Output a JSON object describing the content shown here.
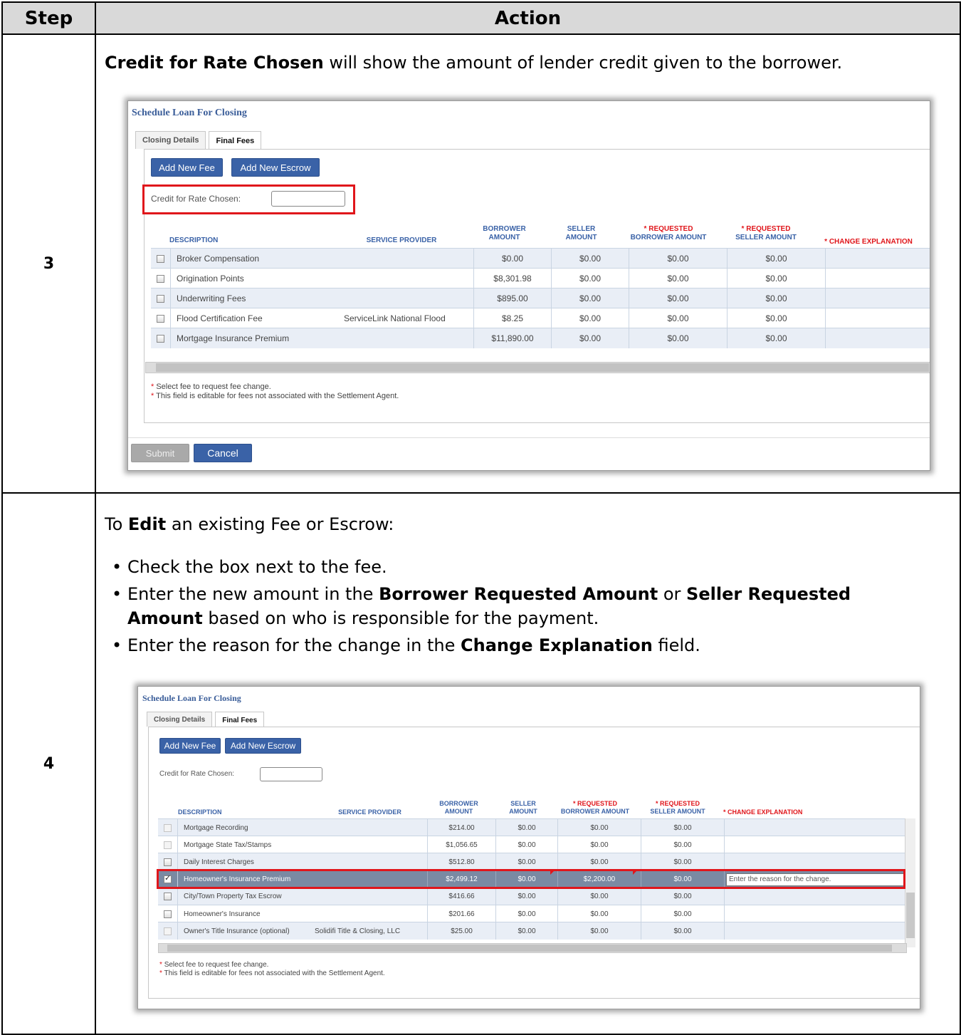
{
  "table": {
    "header_step": "Step",
    "header_action": "Action"
  },
  "step3": {
    "number": "3",
    "intro_bold": "Credit for Rate Chosen",
    "intro_rest": " will show the amount of lender credit given to the borrower.",
    "screenshot": {
      "title": "Schedule Loan For Closing",
      "tabs": [
        "Closing Details",
        "Final Fees"
      ],
      "add_fee": "Add New Fee",
      "add_escrow": "Add New Escrow",
      "credit_label": "Credit for Rate Chosen:",
      "columns": {
        "description": "DESCRIPTION",
        "provider": "SERVICE PROVIDER",
        "borrower_1": "BORROWER",
        "borrower_2": "AMOUNT",
        "seller_1": "SELLER",
        "seller_2": "AMOUNT",
        "req_borrower_1": "REQUESTED",
        "req_borrower_2": "BORROWER AMOUNT",
        "req_seller_1": "REQUESTED",
        "req_seller_2": "SELLER AMOUNT",
        "explanation": "CHANGE EXPLANATION",
        "required_mark": "*"
      },
      "rows": [
        {
          "description": "Broker Compensation",
          "provider": "",
          "borrower": "$0.00",
          "seller": "$0.00",
          "req_borrower": "$0.00",
          "req_seller": "$0.00"
        },
        {
          "description": "Origination Points",
          "provider": "",
          "borrower": "$8,301.98",
          "seller": "$0.00",
          "req_borrower": "$0.00",
          "req_seller": "$0.00"
        },
        {
          "description": "Underwriting Fees",
          "provider": "",
          "borrower": "$895.00",
          "seller": "$0.00",
          "req_borrower": "$0.00",
          "req_seller": "$0.00"
        },
        {
          "description": "Flood Certification Fee",
          "provider": "ServiceLink National Flood",
          "borrower": "$8.25",
          "seller": "$0.00",
          "req_borrower": "$0.00",
          "req_seller": "$0.00"
        },
        {
          "description": "Mortgage Insurance Premium",
          "provider": "",
          "borrower": "$11,890.00",
          "seller": "$0.00",
          "req_borrower": "$0.00",
          "req_seller": "$0.00"
        }
      ],
      "note_1": "Select fee to request fee change.",
      "note_2": "This field is editable for fees not associated with the Settlement Agent.",
      "submit": "Submit",
      "cancel": "Cancel"
    }
  },
  "step4": {
    "number": "4",
    "intro_pre": "To ",
    "intro_bold": "Edit",
    "intro_rest": " an existing Fee or Escrow:",
    "bullets": {
      "b1": "Check the box next to the fee.",
      "b2_pre": "Enter the new amount in the ",
      "b2_bold1": "Borrower Requested Amount",
      "b2_mid": " or ",
      "b2_bold2": "Seller Requested Amount",
      "b2_rest": " based on who is responsible for the payment.",
      "b3_pre": "Enter the reason for the change in the ",
      "b3_bold": "Change Explanation",
      "b3_rest": " field."
    },
    "screenshot": {
      "title": "Schedule Loan For Closing",
      "tabs": [
        "Closing Details",
        "Final Fees"
      ],
      "add_fee": "Add New Fee",
      "add_escrow": "Add New Escrow",
      "credit_label": "Credit for Rate Chosen:",
      "rows": [
        {
          "description": "Mortgage Recording",
          "provider": "",
          "borrower": "$214.00",
          "seller": "$0.00",
          "req_borrower": "$0.00",
          "req_seller": "$0.00",
          "checked": false
        },
        {
          "description": "Mortgage State Tax/Stamps",
          "provider": "",
          "borrower": "$1,056.65",
          "seller": "$0.00",
          "req_borrower": "$0.00",
          "req_seller": "$0.00",
          "checked": false
        },
        {
          "description": "Daily Interest Charges",
          "provider": "",
          "borrower": "$512.80",
          "seller": "$0.00",
          "req_borrower": "$0.00",
          "req_seller": "$0.00",
          "checked": false
        },
        {
          "description": "Homeowner's Insurance Premium",
          "provider": "",
          "borrower": "$2,499.12",
          "seller": "$0.00",
          "req_borrower": "$2,200.00",
          "req_seller": "$0.00",
          "checked": true,
          "explanation": "Enter the reason for the change."
        },
        {
          "description": "City/Town Property Tax Escrow",
          "provider": "",
          "borrower": "$416.66",
          "seller": "$0.00",
          "req_borrower": "$0.00",
          "req_seller": "$0.00",
          "checked": false
        },
        {
          "description": "Homeowner's Insurance",
          "provider": "",
          "borrower": "$201.66",
          "seller": "$0.00",
          "req_borrower": "$0.00",
          "req_seller": "$0.00",
          "checked": false
        },
        {
          "description": "Owner's Title Insurance (optional)",
          "provider": "Solidifi Title & Closing, LLC",
          "borrower": "$25.00",
          "seller": "$0.00",
          "req_borrower": "$0.00",
          "req_seller": "$0.00",
          "checked": false
        }
      ],
      "note_1": "Select fee to request fee change.",
      "note_2": "This field is editable for fees not associated with the Settlement Agent."
    }
  },
  "colors": {
    "accent": "#3a62a7",
    "highlight": "#e0161b",
    "row_alt": "#e9eef6",
    "selected_row": "#7a8aa3"
  }
}
